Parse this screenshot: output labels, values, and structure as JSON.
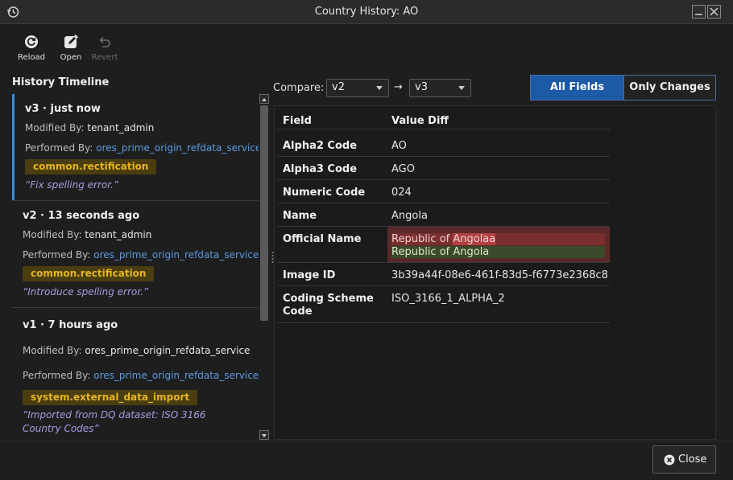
{
  "window": {
    "title": "Country History: AO"
  },
  "toolbar": {
    "reload_label": "Reload",
    "open_label": "Open",
    "revert_label": "Revert"
  },
  "timeline": {
    "heading": "History Timeline",
    "entries": [
      {
        "title": "v3 · just now",
        "modified_label": "Modified By:",
        "modified_by": "tenant_admin",
        "performed_label": "Performed By:",
        "performed_by": "ores_prime_origin_refdata_service",
        "tag": "common.rectification",
        "comment": "“Fix spelling error.”"
      },
      {
        "title": "v2 · 13 seconds ago",
        "modified_label": "Modified By:",
        "modified_by": "tenant_admin",
        "performed_label": "Performed By:",
        "performed_by": "ores_prime_origin_refdata_service",
        "tag": "common.rectification",
        "comment": "“Introduce spelling error.”"
      },
      {
        "title": "v1 · 7 hours ago",
        "modified_label": "Modified By:",
        "modified_by": "ores_prime_origin_refdata_service",
        "performed_label": "Performed By:",
        "performed_by": "ores_prime_origin_refdata_service",
        "tag": "system.external_data_import",
        "comment": "“Imported from DQ dataset: ISO 3166 Country Codes”"
      }
    ]
  },
  "compare": {
    "label": "Compare:",
    "from": "v2",
    "arrow": "→",
    "to": "v3"
  },
  "view_toggle": {
    "all_fields": "All Fields",
    "only_changes": "Only Changes",
    "selected": "All Fields"
  },
  "diff_table": {
    "headers": {
      "field": "Field",
      "value": "Value Diff"
    },
    "rows": [
      {
        "field": "Alpha2 Code",
        "value": "AO"
      },
      {
        "field": "Alpha3 Code",
        "value": "AGO"
      },
      {
        "field": "Numeric Code",
        "value": "024"
      },
      {
        "field": "Name",
        "value": "Angola"
      },
      {
        "field": "Official Name",
        "old_prefix": "Republic of ",
        "old_highlight": "Angolaa",
        "new_value": "Republic of Angola"
      },
      {
        "field": "Image ID",
        "value": "3b39a44f-08e6-461f-83d5-f6773e2368c8"
      },
      {
        "field": "Coding Scheme Code",
        "value": "ISO_3166_1_ALPHA_2"
      }
    ]
  },
  "footer": {
    "close_label": "Close"
  },
  "colors": {
    "accent": "#1c5aa6",
    "link": "#5b9be0",
    "tag_text": "#e6b423",
    "tag_bg": "#4a3e10",
    "comment": "#a99ce0",
    "diff_removed": "#7a2e2e",
    "diff_added": "#3a4a2a"
  }
}
